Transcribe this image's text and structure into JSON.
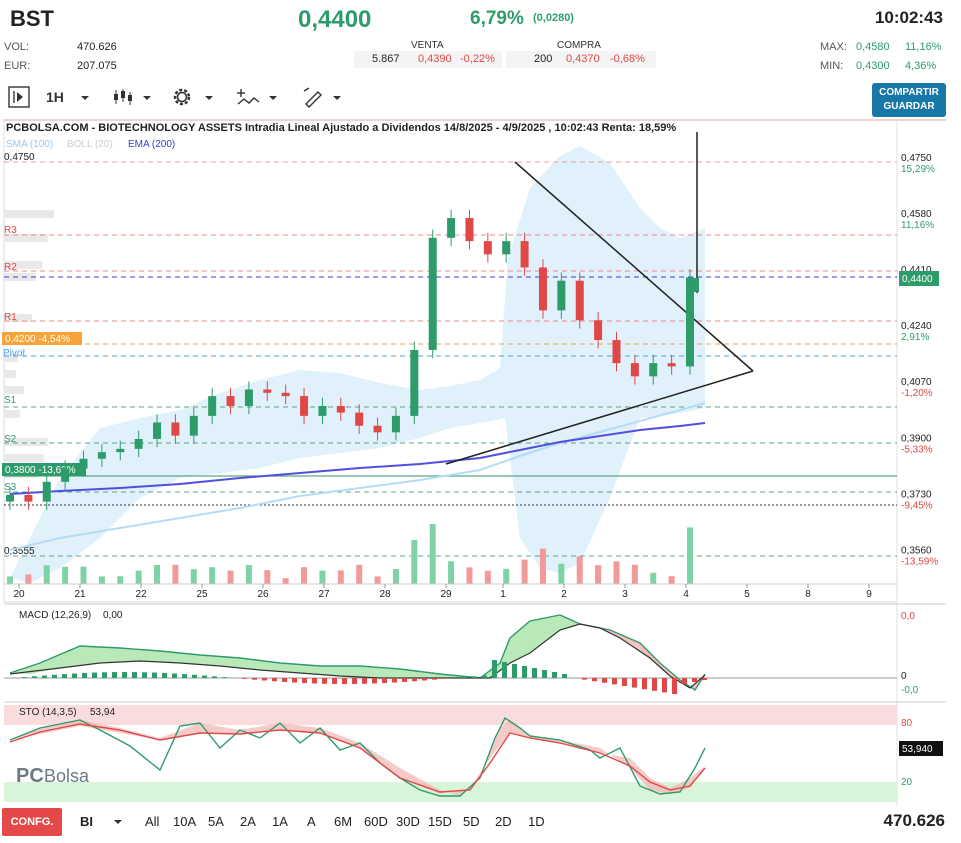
{
  "header": {
    "ticker": "BST",
    "price": "0,4400",
    "change_pct": "6,79%",
    "change_abs": "(0,0280)",
    "time": "10:02:43"
  },
  "stats": {
    "vol_label": "VOL:",
    "vol_value": "470.626",
    "eur_label": "EUR:",
    "eur_value": "207.075",
    "max_label": "MAX:",
    "max_value": "0,4580",
    "max_pct": "11,16%",
    "min_label": "MIN:",
    "min_value": "0,4300",
    "min_pct": "4,36%"
  },
  "bid_ask": {
    "sell_label": "VENTA",
    "sell_qty": "5.867",
    "sell_price": "0,4390",
    "sell_pct": "-0,22%",
    "buy_label": "COMPRA",
    "buy_qty": "200",
    "buy_price": "0,4370",
    "buy_pct": "-0,68%"
  },
  "toolbar": {
    "timeframe": "1H",
    "share_label": "COMPARTIR",
    "save_label": "GUARDAR",
    "icons": [
      "play-icon",
      "chevron-down-icon",
      "candles-icon",
      "gear-icon",
      "indicators-icon",
      "pencil-icon"
    ]
  },
  "chart_title": "PCBOLSA.COM - BIOTECHNOLOGY ASSETS Intradia Lineal Ajustado a Dividendos 14/8/2025 - 4/9/2025 , 10:02:43 Renta: 18,59%",
  "legend": {
    "sma": "SMA (100)",
    "boll": "BOLL (20)",
    "ema": "EMA (200)"
  },
  "level_labels": {
    "r3": "R3",
    "r2": "R2",
    "r1": "R1",
    "pivot": "Pivot",
    "s1": "S1",
    "s2": "S2",
    "s3": "S3",
    "max_left": "0,4750",
    "min_left": "0,3555",
    "tag_0420": "0,4200 -4,54%",
    "tag_0380": "0,3800 -13,63%",
    "tag_last": "0,4400"
  },
  "price_axis": [
    {
      "v": "0,4750",
      "p": "15,29%"
    },
    {
      "v": "0,4580",
      "p": "11,16%"
    },
    {
      "v": "0,4410",
      "p": ""
    },
    {
      "v": "0,4240",
      "p": "2,91%"
    },
    {
      "v": "0,4070",
      "p": "-1,20%"
    },
    {
      "v": "0,3900",
      "p": "-5,33%"
    },
    {
      "v": "0,3730",
      "p": "-9,45%"
    },
    {
      "v": "0,3560",
      "p": "-13,59%"
    }
  ],
  "x_axis": [
    "20",
    "21",
    "22",
    "25",
    "26",
    "27",
    "28",
    "29",
    "1",
    "2",
    "3",
    "4",
    "5",
    "8",
    "9"
  ],
  "macd": {
    "label": "MACD (12,26,9)",
    "value": "0,00",
    "axis_top": "0,0",
    "axis_zero": "0",
    "axis_neg": "-0,0"
  },
  "sto": {
    "label": "STO (14,3,5)",
    "value": "53,94",
    "axis_high": "80",
    "axis_low": "20",
    "tag": "53,940"
  },
  "brand": {
    "pc": "PC",
    "bolsa": "Bolsa"
  },
  "bottom": {
    "conf": "CONFG.",
    "scale": "BI",
    "ranges": [
      "All",
      "10A",
      "5A",
      "2A",
      "1A",
      "A",
      "6M",
      "60D",
      "30D",
      "15D",
      "5D",
      "2D",
      "1D"
    ],
    "volume": "470.626"
  },
  "colors": {
    "up": "#2e9c6a",
    "down": "#e04848",
    "accent": "#1777a7"
  },
  "chart_data": {
    "type": "candlestick",
    "title": "PCBOLSA.COM - BIOTECHNOLOGY ASSETS Intradia Lineal Ajustado a Dividendos 14/8/2025 - 4/9/2025 , 10:02:43 Renta: 18,59%",
    "ylim": [
      0.3555,
      0.475
    ],
    "x_categories": [
      "20",
      "21",
      "22",
      "25",
      "26",
      "27",
      "28",
      "29",
      "1",
      "2",
      "3",
      "4",
      "5",
      "8",
      "9"
    ],
    "levels": {
      "R3": 0.45,
      "R2": 0.44,
      "R1": 0.4245,
      "Pivot": 0.4172,
      "S1": 0.409,
      "S2": 0.3985,
      "S3": 0.3885,
      "tag_0420": 0.42,
      "tag_0380": 0.38
    },
    "last": 0.44,
    "max": 0.458,
    "min": 0.43,
    "candles_close": [
      0.374,
      0.372,
      0.378,
      0.382,
      0.385,
      0.387,
      0.388,
      0.391,
      0.396,
      0.392,
      0.398,
      0.404,
      0.401,
      0.406,
      0.405,
      0.404,
      0.398,
      0.401,
      0.399,
      0.395,
      0.393,
      0.398,
      0.418,
      0.452,
      0.458,
      0.451,
      0.447,
      0.451,
      0.443,
      0.43,
      0.439,
      0.427,
      0.421,
      0.414,
      0.41,
      0.414,
      0.413,
      0.44
    ]
  }
}
